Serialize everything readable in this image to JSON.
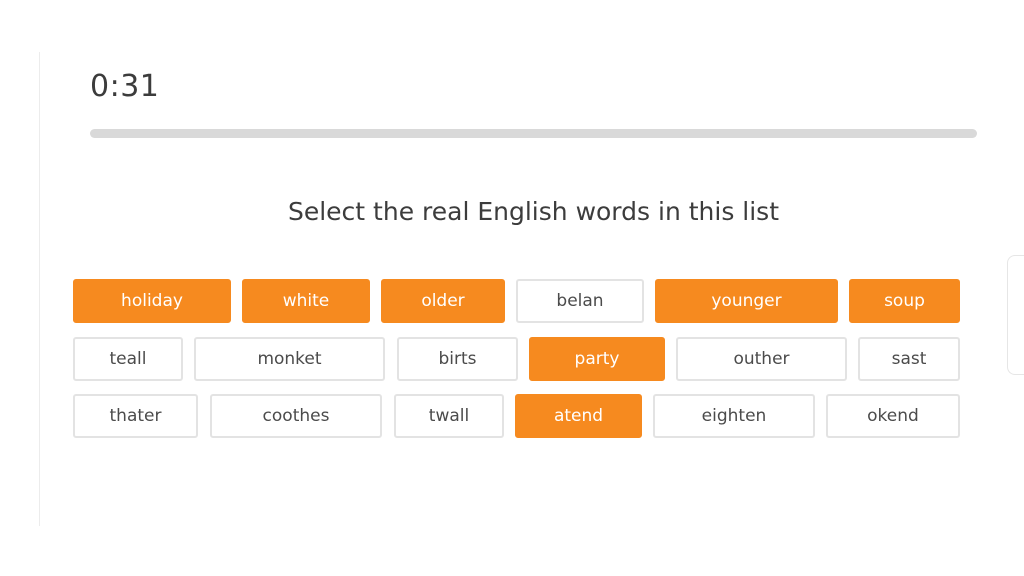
{
  "timer": "0:31",
  "progress_fraction": 0.0,
  "prompt": "Select the real English words in this list",
  "colors": {
    "accent": "#f68a1f",
    "track": "#d9d9d9",
    "text": "#3c3c3c",
    "border": "#e3e3e3"
  },
  "words": [
    {
      "label": "holiday",
      "selected": true
    },
    {
      "label": "white",
      "selected": true
    },
    {
      "label": "older",
      "selected": true
    },
    {
      "label": "belan",
      "selected": false
    },
    {
      "label": "younger",
      "selected": true
    },
    {
      "label": "soup",
      "selected": true
    },
    {
      "label": "teall",
      "selected": false
    },
    {
      "label": "monket",
      "selected": false
    },
    {
      "label": "birts",
      "selected": false
    },
    {
      "label": "party",
      "selected": true
    },
    {
      "label": "outher",
      "selected": false
    },
    {
      "label": "sast",
      "selected": false
    },
    {
      "label": "thater",
      "selected": false
    },
    {
      "label": "coothes",
      "selected": false
    },
    {
      "label": "twall",
      "selected": false
    },
    {
      "label": "atend",
      "selected": true
    },
    {
      "label": "eighten",
      "selected": false
    },
    {
      "label": "okend",
      "selected": false
    }
  ]
}
